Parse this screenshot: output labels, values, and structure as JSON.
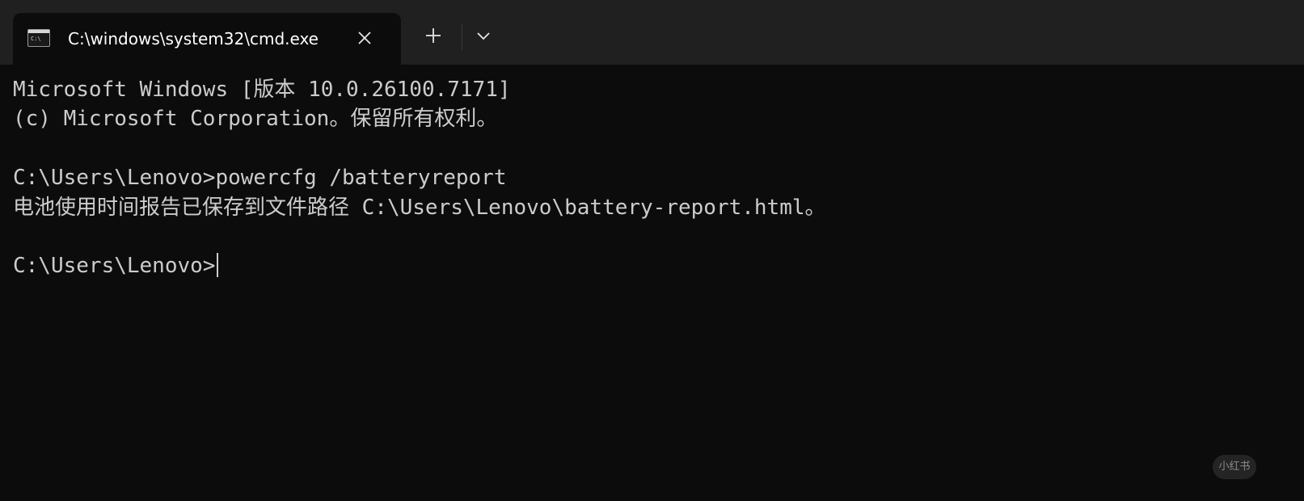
{
  "tab": {
    "icon": "command-prompt-icon",
    "title": "C:\\windows\\system32\\cmd.exe"
  },
  "tabbar": {
    "close_icon": "close-icon",
    "new_tab_icon": "plus-icon",
    "dropdown_icon": "chevron-down-icon"
  },
  "console": {
    "lines": [
      "Microsoft Windows [版本 10.0.26100.7171]",
      "(c) Microsoft Corporation。保留所有权利。",
      "",
      "C:\\Users\\Lenovo>powercfg /batteryreport",
      "电池使用时间报告已保存到文件路径 C:\\Users\\Lenovo\\battery-report.html。",
      "",
      "C:\\Users\\Lenovo>"
    ]
  },
  "watermark": {
    "text": "小红书"
  },
  "colors": {
    "tabbar_bg": "#202020",
    "console_bg": "#0c0c0c",
    "console_text": "#cccccc",
    "tab_title": "#ffffff"
  }
}
